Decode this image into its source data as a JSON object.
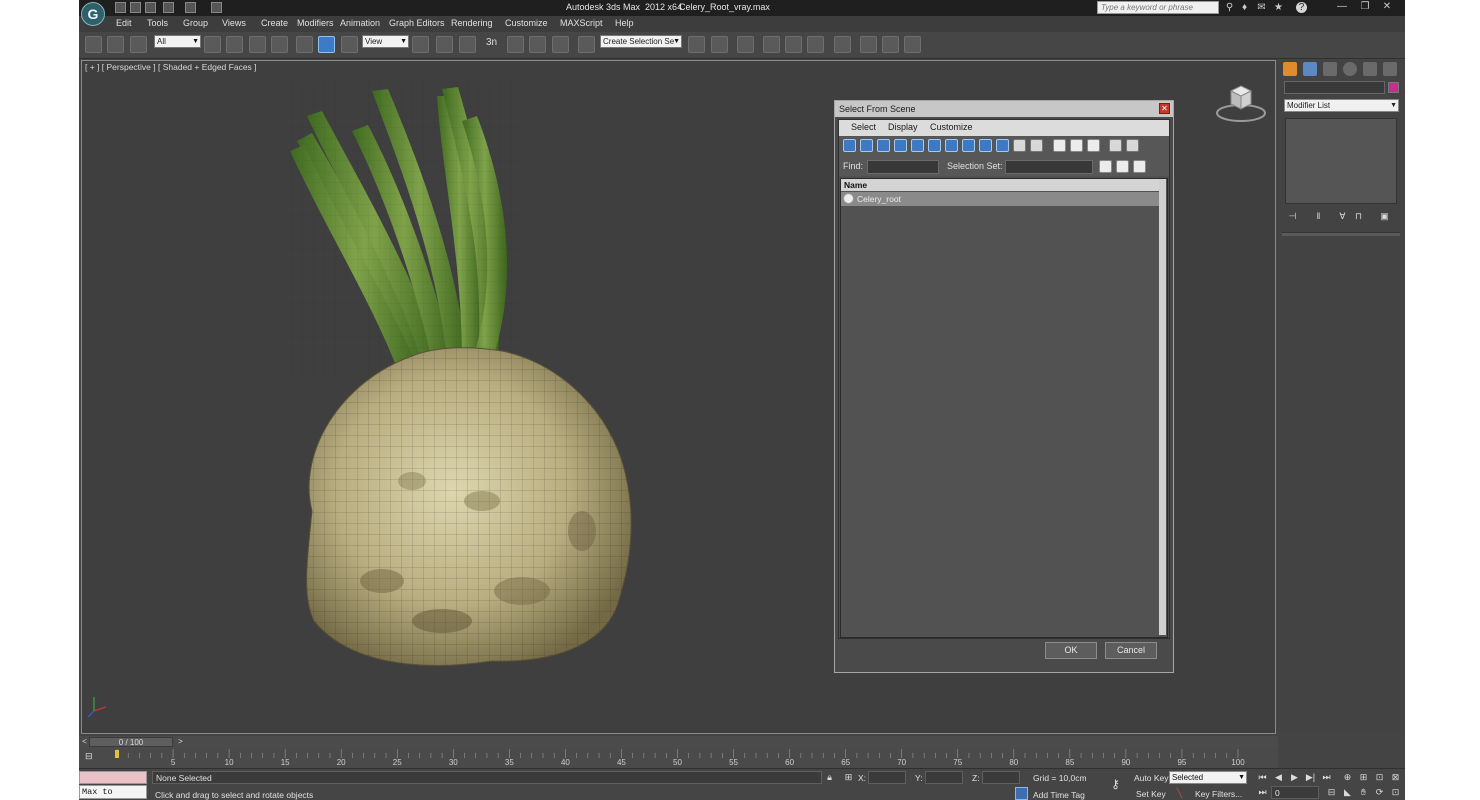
{
  "app": {
    "title": "Autodesk 3ds Max  2012 x64",
    "file": "Celery_Root_vray.max",
    "logo_glyph": "G"
  },
  "infocenter": {
    "search_placeholder": "Type a keyword or phrase",
    "help_glyph": "?"
  },
  "window_buttons": {
    "minimize": "—",
    "restore": "❐",
    "close": "✕"
  },
  "menu": [
    "Edit",
    "Tools",
    "Group",
    "Views",
    "Create",
    "Modifiers",
    "Animation",
    "Graph Editors",
    "Rendering",
    "Customize",
    "MAXScript",
    "Help"
  ],
  "toolbar": {
    "selection_filter": "All",
    "reference_coord": "View",
    "named_selection": "Create Selection Se",
    "snap_label": "3n"
  },
  "viewport": {
    "label": "[ + ] [ Perspective ] [ Shaded + Edged Faces ]",
    "object": "Celery_root"
  },
  "dialog": {
    "title": "Select From Scene",
    "close_glyph": "✕",
    "menu": [
      "Select",
      "Display",
      "Customize"
    ],
    "find_label": "Find:",
    "selection_set_label": "Selection Set:",
    "column_name": "Name",
    "rows": [
      "Celery_root"
    ],
    "ok_label": "OK",
    "cancel_label": "Cancel"
  },
  "command_panel": {
    "modifier_list": "Modifier List",
    "color": "#c42f8e"
  },
  "timeslider": {
    "frame_label": "0 / 100",
    "prev": "<",
    "next": ">"
  },
  "trackbar": {
    "ticks": [
      "5",
      "10",
      "15",
      "20",
      "25",
      "30",
      "35",
      "40",
      "45",
      "50",
      "55",
      "60",
      "65",
      "70",
      "75",
      "80",
      "85",
      "90",
      "95",
      "100"
    ]
  },
  "status": {
    "maxscript": "Max to Physc.",
    "selection": "None Selected",
    "prompt": "Click and drag to select and rotate objects",
    "x_label": "X:",
    "y_label": "Y:",
    "z_label": "Z:",
    "grid": "Grid = 10,0cm",
    "add_time_tag": "Add Time Tag",
    "auto_key": "Auto Key",
    "auto_key_mode": "Selected",
    "set_key": "Set Key",
    "key_filters": "Key Filters...",
    "current_frame": "0"
  },
  "playback": {
    "goto_start": "⏮",
    "prev_frame": "◀",
    "play": "▶",
    "next_frame": "▶|",
    "goto_end": "⏭"
  }
}
